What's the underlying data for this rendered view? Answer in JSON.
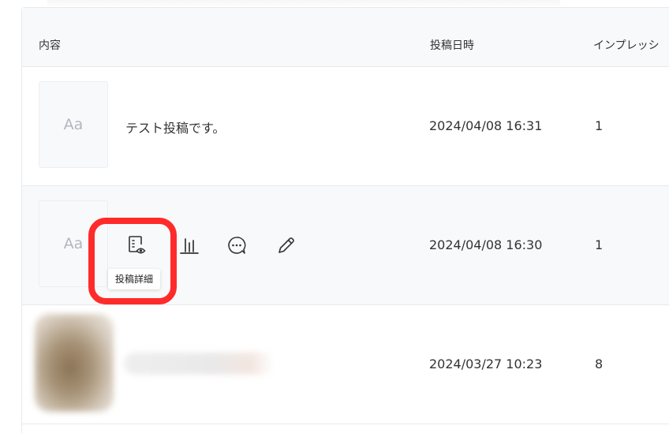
{
  "table": {
    "columns": [
      "内容",
      "投稿日時",
      "インプレッシ"
    ]
  },
  "rows": [
    {
      "thumb_label": "Aa",
      "content": "テスト投稿です。",
      "date": "2024/04/08 16:31",
      "impressions": "1"
    },
    {
      "thumb_label": "Aa",
      "content": "",
      "date": "2024/04/08 16:30",
      "impressions": "1"
    },
    {
      "thumb_label": "",
      "content": "",
      "date": "2024/03/27 10:23",
      "impressions": "8"
    }
  ],
  "actions": {
    "tooltip": "投稿詳細",
    "icons": [
      "post-detail-icon",
      "bar-chart-icon",
      "comment-icon",
      "pencil-icon"
    ]
  },
  "colors": {
    "highlight": "#ff2b2b",
    "header_bg": "#f8f9fb",
    "border": "#e8e9ee",
    "text": "#333333",
    "icon": "#333333"
  }
}
